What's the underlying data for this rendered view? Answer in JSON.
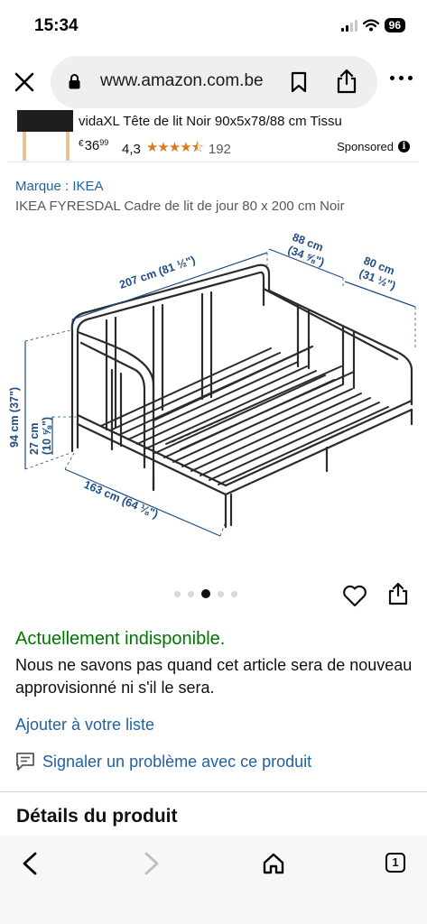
{
  "status_bar": {
    "time": "15:34",
    "battery": "96",
    "icons": [
      "cellular-signal-icon",
      "wifi-icon",
      "battery-icon"
    ]
  },
  "browser": {
    "url": "www.amazon.com.be",
    "icons": [
      "close-icon",
      "lock-icon",
      "bookmark-icon",
      "share-icon",
      "more-icon"
    ]
  },
  "sponsored_ad": {
    "title": "vidaXL Tête de lit Noir 90x5x78/88 cm Tissu",
    "price_currency": "€",
    "price_whole": "36",
    "price_fraction": "99",
    "rating": "4,3",
    "stars": "★★★★⯪",
    "rating_value": 4.3,
    "review_count": "192",
    "sponsored_label": "Sponsored"
  },
  "product": {
    "brand": "Marque : IKEA",
    "title": "IKEA FYRESDAL Cadre de lit de jour 80 x 200 cm Noir"
  },
  "dimensions": {
    "length": "207 cm (81 ½\")",
    "depth": "88 cm",
    "depth_in": "(34 ⅝\")",
    "width": "80 cm",
    "width_in": "(31 ½\")",
    "height": "94 cm (37\")",
    "seat_height": "27 cm",
    "seat_height_in": "(10 ⅝\")",
    "extended": "163 cm (64 ⅛\")"
  },
  "carousel": {
    "count": 5,
    "active_index": 2
  },
  "availability": {
    "status": "Actuellement indisponible.",
    "description": "Nous ne savons pas quand cet article sera de nouveau approvisionné ni s'il le sera.",
    "add_to_list": "Ajouter à votre liste",
    "report": "Signaler un problème avec ce produit"
  },
  "details": {
    "title": "Détails du produit"
  },
  "toolbar": {
    "tabs_count": "1",
    "icons": [
      "back-icon",
      "forward-icon",
      "home-icon",
      "tabs-icon"
    ]
  },
  "colors": {
    "link": "#2162a1",
    "available_green": "#007600",
    "star": "#de7921"
  }
}
